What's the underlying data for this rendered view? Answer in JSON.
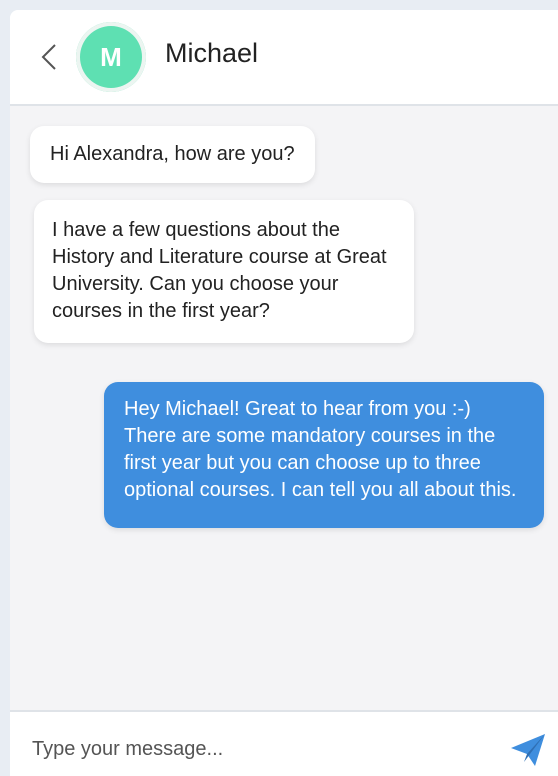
{
  "header": {
    "back_icon": "chevron-left-icon",
    "avatar_initial": "M",
    "avatar_color": "#5ee0b2",
    "contact_name": "Michael"
  },
  "messages": [
    {
      "direction": "incoming",
      "text": "Hi Alexandra, how are you?"
    },
    {
      "direction": "incoming",
      "text": "I have a few questions about the History and Literature course at Great University. Can you choose your courses in the first year?"
    },
    {
      "direction": "outgoing",
      "text": "Hey Michael! Great to hear from you :-) There are some mandatory courses in the first year but you can choose up to three optional courses. I can tell you all about this."
    }
  ],
  "composer": {
    "placeholder": "Type your message...",
    "value": "",
    "send_icon": "paper-plane-icon"
  },
  "colors": {
    "accent": "#3f8ede",
    "outgoing_bubble": "#3f8ede",
    "incoming_bubble": "#ffffff",
    "chat_background": "#f4f4f6"
  }
}
